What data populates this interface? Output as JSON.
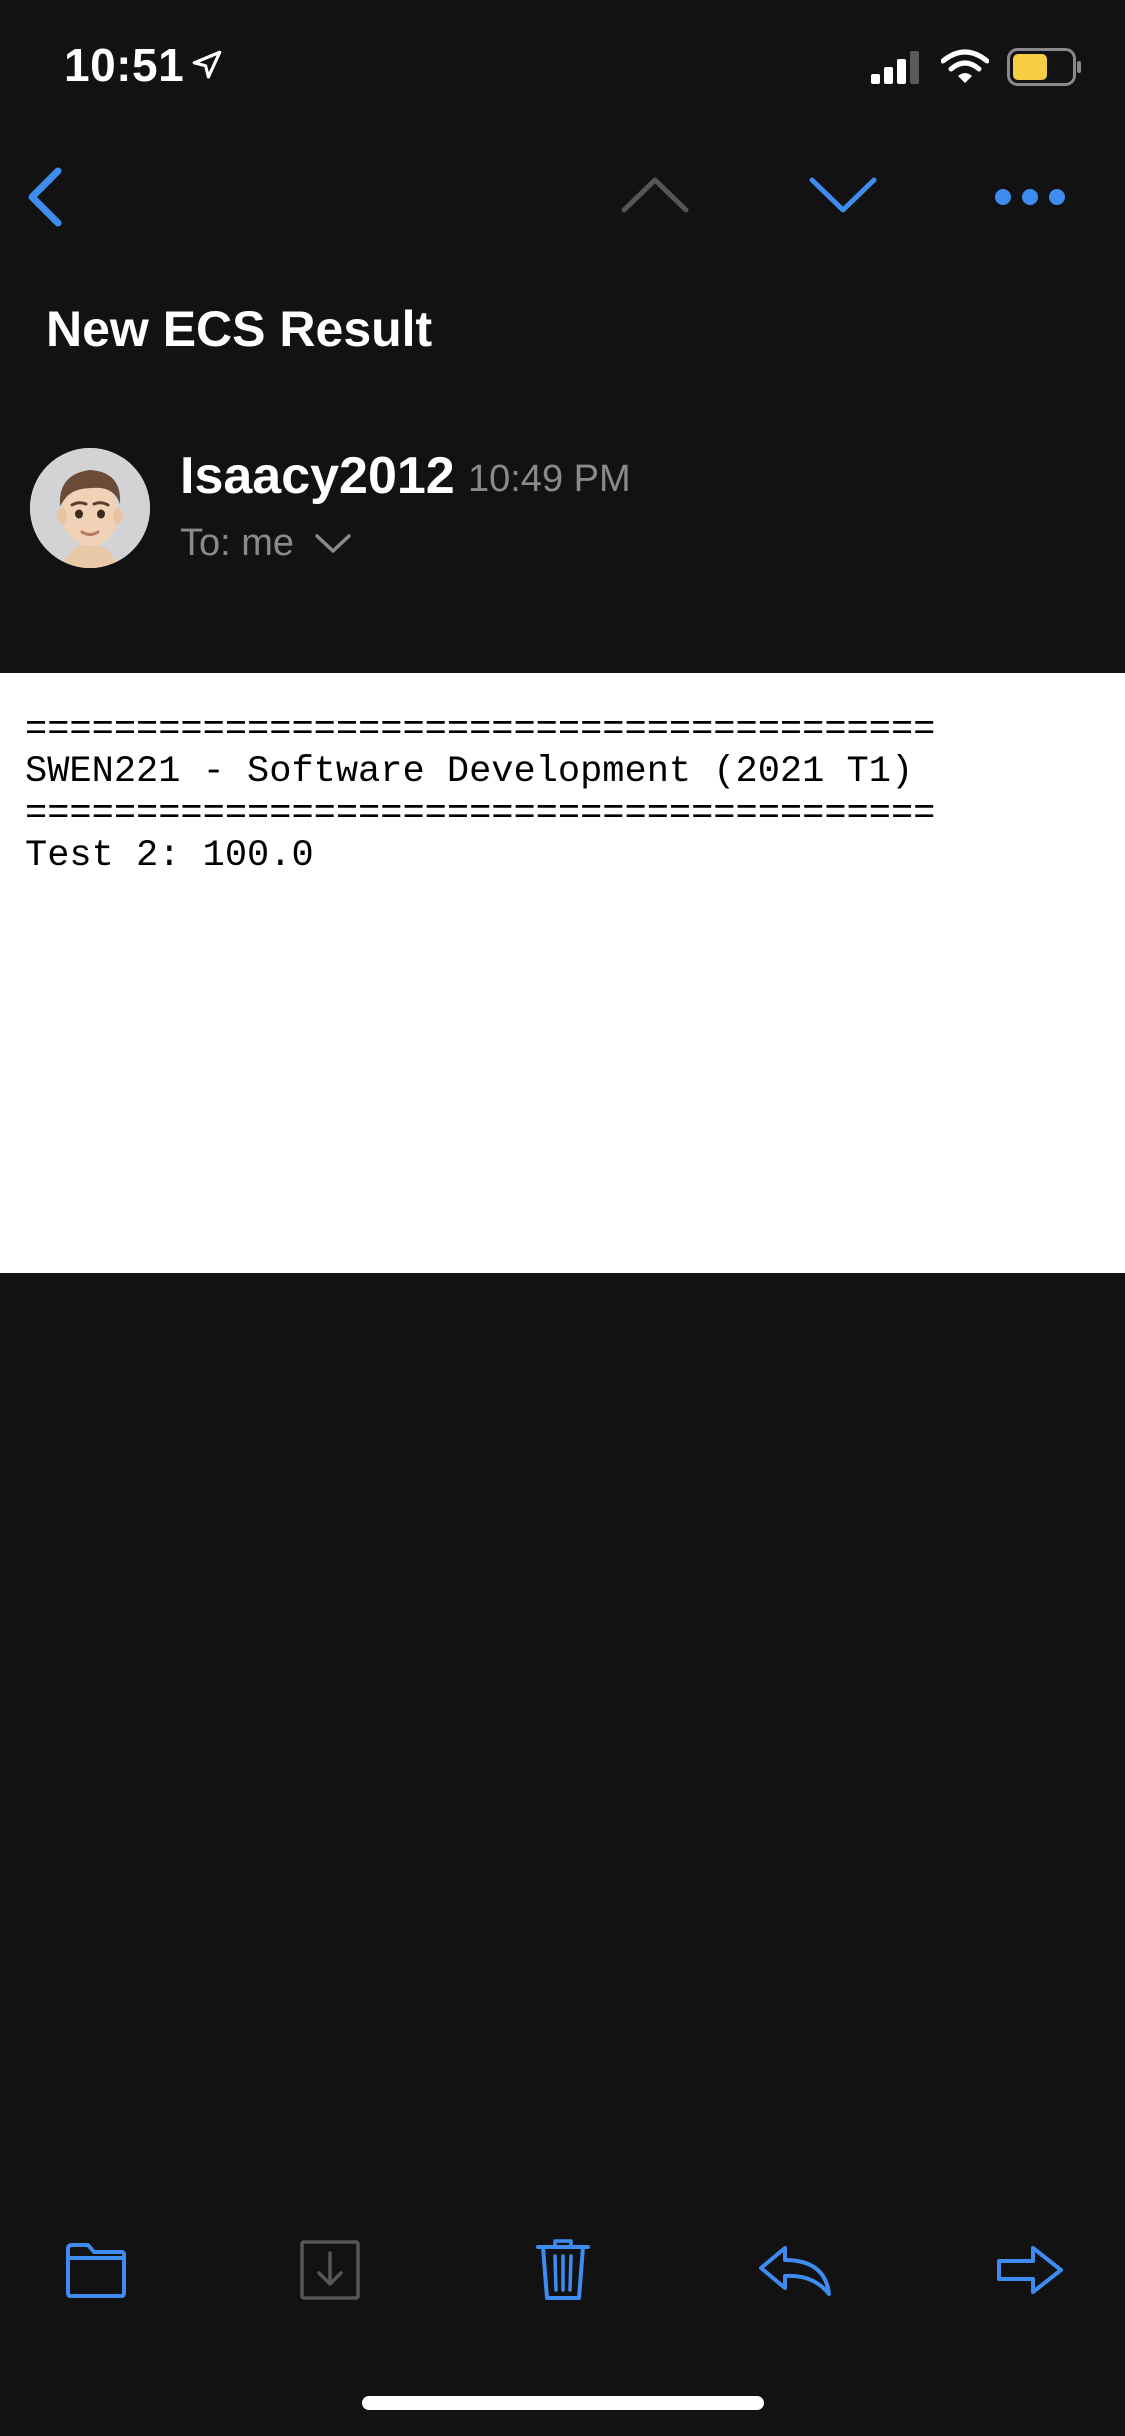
{
  "status_bar": {
    "time": "10:51",
    "icons": [
      "location-arrow-icon",
      "cellular-signal-icon",
      "wifi-icon",
      "battery-icon"
    ],
    "battery_color": "#f7cd46"
  },
  "nav": {
    "back_icon": "chevron-left-icon",
    "prev_icon": "chevron-up-icon",
    "next_icon": "chevron-down-icon",
    "more_icon": "ellipsis-icon",
    "accent_color": "#3f8cf1"
  },
  "message": {
    "subject": "New ECS Result",
    "sender": "Isaacy2012",
    "time": "10:49 PM",
    "recipients": "To: me",
    "body_lines": [
      "=========================================",
      "SWEN221 - Software Development (2021 T1)",
      "=========================================",
      "Test 2: 100.0"
    ]
  },
  "toolbar": {
    "items": [
      "folder-icon",
      "archive-icon",
      "trash-icon",
      "reply-icon",
      "forward-icon"
    ]
  }
}
